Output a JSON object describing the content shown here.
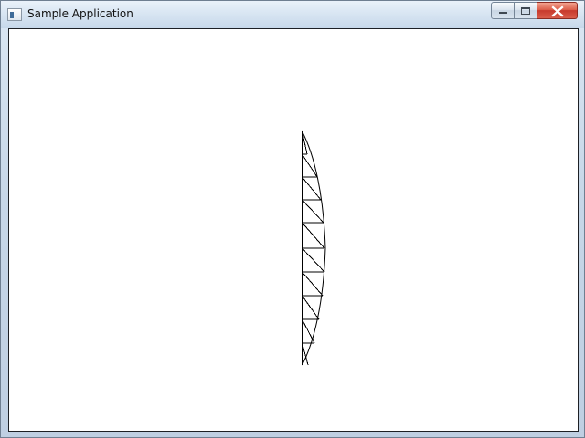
{
  "window": {
    "title": "Sample Application",
    "app_icon": "application-window-icon",
    "controls": [
      {
        "name": "minimize-button",
        "icon": "minimize-icon"
      },
      {
        "name": "maximize-button",
        "icon": "maximize-icon"
      },
      {
        "name": "close-button",
        "icon": "close-icon"
      }
    ]
  },
  "canvas": {
    "background": "#ffffff",
    "stroke_color": "#000000",
    "drawing": "curved-truss-wireframe"
  }
}
